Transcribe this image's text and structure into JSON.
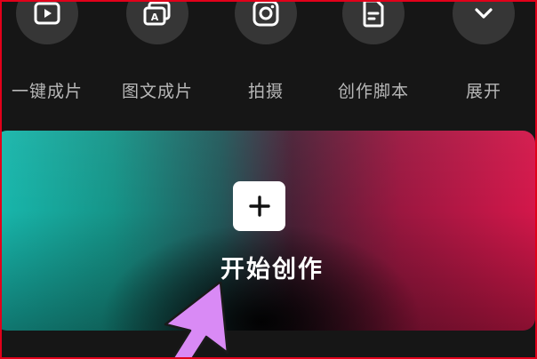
{
  "tools": [
    {
      "label": "一键成片",
      "icon": "play-video-icon"
    },
    {
      "label": "图文成片",
      "icon": "text-to-video-icon"
    },
    {
      "label": "拍摄",
      "icon": "camera-icon"
    },
    {
      "label": "创作脚本",
      "icon": "script-document-icon"
    },
    {
      "label": "展开",
      "icon": "chevron-down-icon"
    }
  ],
  "create": {
    "label": "开始创作",
    "icon": "plus-icon"
  },
  "colors": {
    "frame": "#e2001a",
    "background": "#161616",
    "tool_circle": "#363636",
    "tool_label": "#b8b8b8",
    "gradient_left": "#18b8ad",
    "gradient_right": "#d3174a",
    "annotation_arrow": "#d98af5"
  }
}
